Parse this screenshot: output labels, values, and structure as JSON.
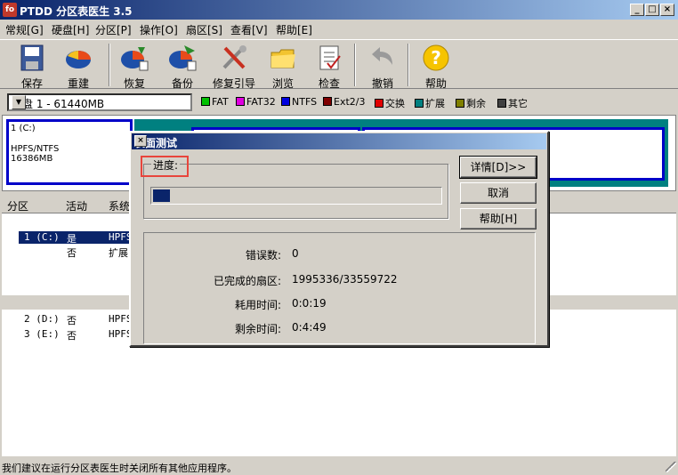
{
  "window": {
    "title": "PTDD 分区表医生 3.5",
    "logo_text": "fo",
    "min": "_",
    "max": "□",
    "close": "×"
  },
  "menu": [
    "常规[G]",
    "硬盘[H]",
    "分区[P]",
    "操作[O]",
    "扇区[S]",
    "查看[V]",
    "帮助[E]"
  ],
  "toolbar": [
    {
      "label": "保存",
      "icon": "floppy-save-icon"
    },
    {
      "label": "重建",
      "icon": "pie-rebuild-icon"
    },
    {
      "label": "恢复",
      "icon": "pie-restore-icon"
    },
    {
      "label": "备份",
      "icon": "pie-backup-icon"
    },
    {
      "label": "修复引导",
      "icon": "tools-icon"
    },
    {
      "label": "浏览",
      "icon": "folder-icon"
    },
    {
      "label": "检查",
      "icon": "checklist-icon"
    },
    {
      "label": "撤销",
      "icon": "undo-icon"
    },
    {
      "label": "帮助",
      "icon": "help-icon"
    }
  ],
  "disk_select": {
    "value": "硬盘 1 - 61440MB"
  },
  "legend": [
    {
      "label": "FAT",
      "color": "#00c000"
    },
    {
      "label": "FAT32",
      "color": "#e000e0"
    },
    {
      "label": "NTFS",
      "color": "#0000e0"
    },
    {
      "label": "Ext2/3",
      "color": "#800000"
    },
    {
      "label": "交换",
      "color": "#e00000"
    },
    {
      "label": "扩展",
      "color": "#008080"
    },
    {
      "label": "剩余",
      "color": "#808000"
    },
    {
      "label": "其它",
      "color": "#404040"
    }
  ],
  "partition_map": {
    "c_name": "1 (C:)",
    "c_fs": "HPFS/NTFS",
    "c_size": "16386MB"
  },
  "list_header": {
    "col1": "分区",
    "col2": "活动",
    "col3": "系统"
  },
  "list_rows": [
    {
      "num": "1 (C:)",
      "active": "是",
      "fs": "HPFS"
    },
    {
      "num": "",
      "active": "否",
      "fs": "扩展"
    }
  ],
  "list_rows2": [
    {
      "num": "2 (D:)",
      "active": "否",
      "fs": "HPFS"
    },
    {
      "num": "3 (E:)",
      "active": "否",
      "fs": "HPFS"
    }
  ],
  "status": "我们建议在运行分区表医生时关闭所有其他应用程序。",
  "dialog": {
    "title": "表面测试",
    "close": "×",
    "progress_label": "进度:",
    "progress_fraction": 0.059,
    "buttons": {
      "details": "详情[D]>>",
      "cancel": "取消",
      "help": "帮助[H]"
    },
    "info": {
      "errors_label": "错误数:",
      "errors_value": "0",
      "done_label": "已完成的扇区:",
      "done_value": "1995336/33559722",
      "elapsed_label": "耗用时间:",
      "elapsed_value": "0:0:19",
      "remaining_label": "剩余时间:",
      "remaining_value": "0:4:49"
    }
  }
}
